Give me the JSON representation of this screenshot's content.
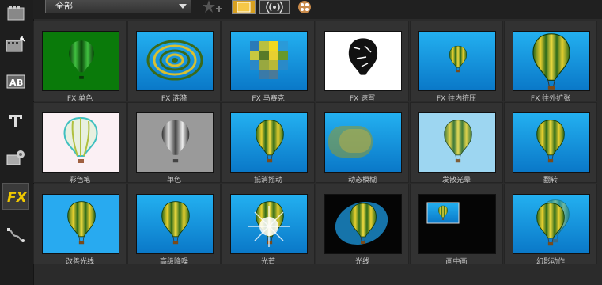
{
  "toolbar": {
    "filter_value": "全部",
    "buttons": [
      "add-effect-icon",
      "thumbnail-view-icon",
      "audio-view-icon",
      "effects-palette-icon"
    ]
  },
  "sidebar": {
    "items": [
      {
        "name": "media-library-icon"
      },
      {
        "name": "instant-project-icon"
      },
      {
        "name": "transition-icon"
      },
      {
        "name": "title-icon"
      },
      {
        "name": "graphic-icon"
      },
      {
        "name": "fx-filter-icon"
      },
      {
        "name": "path-motion-icon"
      }
    ]
  },
  "effects": [
    {
      "label": "FX 单色"
    },
    {
      "label": "FX 涟漪"
    },
    {
      "label": "FX 马赛克"
    },
    {
      "label": "FX 速写"
    },
    {
      "label": "FX 往内挤压"
    },
    {
      "label": "FX 往外扩张"
    },
    {
      "label": "彩色笔"
    },
    {
      "label": "单色"
    },
    {
      "label": "抵消摇动"
    },
    {
      "label": "动态模糊"
    },
    {
      "label": "发散光晕"
    },
    {
      "label": "翻转"
    },
    {
      "label": "改善光线"
    },
    {
      "label": "高级降噪"
    },
    {
      "label": "光芒"
    },
    {
      "label": "光线"
    },
    {
      "label": "画中画"
    },
    {
      "label": "幻影动作"
    }
  ],
  "colors": {
    "sky": "#1a9be0",
    "accent_fx": "#f0c800"
  }
}
